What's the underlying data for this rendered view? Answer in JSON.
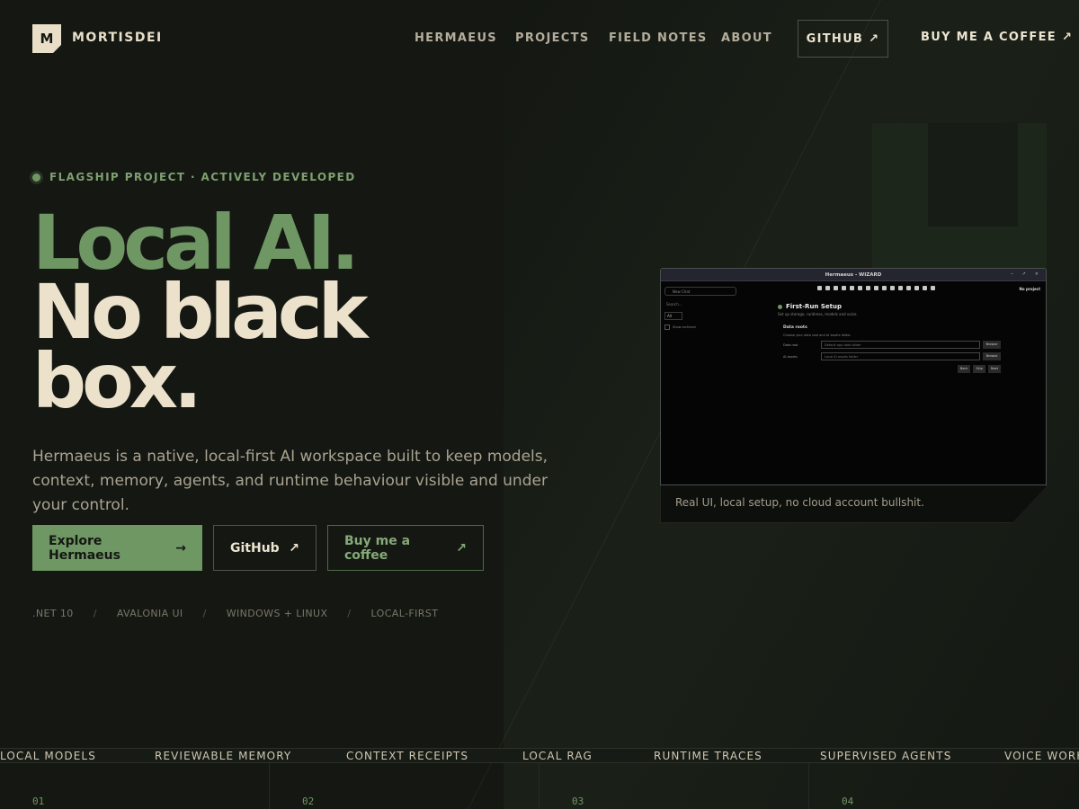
{
  "nav": {
    "brand_mark": "M",
    "brand": "MORTISDEI",
    "links": [
      "HERMAEUS",
      "PROJECTS",
      "FIELD NOTES",
      "ABOUT"
    ],
    "github": "GITHUB",
    "coffee": "BUY ME A COFFEE",
    "arrow": "↗"
  },
  "hero": {
    "eyebrow": "FLAGSHIP PROJECT · ACTIVELY DEVELOPED",
    "headline_1": "Local AI.",
    "headline_2": "No black",
    "headline_3": "box.",
    "lede": "Hermaeus is a native, local-first AI workspace built to keep models, context, memory, agents, and runtime behaviour visible and under your control.",
    "buttons": {
      "primary": "Explore Hermaeus",
      "primary_arrow": "→",
      "github": "GitHub",
      "coffee": "Buy me a coffee",
      "ext_arrow": "↗"
    },
    "tech": [
      ".NET 10",
      "AVALONIA UI",
      "WINDOWS + LINUX",
      "LOCAL-FIRST"
    ],
    "tech_sep": "/"
  },
  "screenshot": {
    "window_title": "Hermaeus - WIZARD",
    "window_controls": [
      "–",
      "↗",
      "×"
    ],
    "sidebar_input": "New Chat",
    "sidebar_search": "Search...",
    "sidebar_filter": "All",
    "sidebar_check": "Show archived",
    "project_label": "No project",
    "wizard_title": "First-Run Setup",
    "wizard_sub": "Set up storage, runtimes, models and voice.",
    "section": "Data roots",
    "hint": "Choose your data root and AI assets folder.",
    "rows": [
      {
        "label": "Data root",
        "placeholder": "Default app data folder",
        "button": "Browse"
      },
      {
        "label": "AI assets",
        "placeholder": "Local AI assets folder",
        "button": "Browse"
      }
    ],
    "actions": [
      "Back",
      "Skip",
      "Next"
    ],
    "caption": "Real UI, local setup, no cloud account bullshit."
  },
  "ticker": [
    "LOCAL MODELS",
    "REVIEWABLE MEMORY",
    "CONTEXT RECEIPTS",
    "LOCAL RAG",
    "RUNTIME TRACES",
    "SUPERVISED AGENTS",
    "VOICE WORKFLOWS"
  ],
  "features": [
    "01",
    "02",
    "03",
    "04"
  ],
  "colors": {
    "background": "#141712",
    "accent": "#6f9764",
    "cream": "#ece2cc"
  }
}
